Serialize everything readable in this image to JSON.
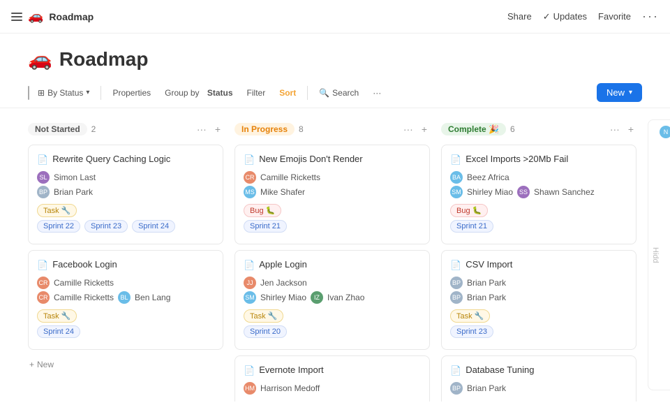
{
  "app": {
    "title": "Roadmap",
    "emoji": "🚗",
    "topnav": {
      "share": "Share",
      "updates": "Updates",
      "favorite": "Favorite",
      "dots": "···"
    }
  },
  "toolbar": {
    "view_by": "By Status",
    "properties": "Properties",
    "group_by_prefix": "Group by",
    "group_by_field": "Status",
    "filter": "Filter",
    "sort": "Sort",
    "search": "Search",
    "more_dots": "···",
    "new_btn": "New"
  },
  "columns": [
    {
      "id": "not-started",
      "label": "Not Started",
      "count": "2",
      "cards": [
        {
          "title": "Rewrite Query Caching Logic",
          "people": [
            "Simon Last",
            "Brian Park"
          ],
          "tag_type": "task",
          "tag_label": "Task 🔧",
          "sprints": [
            "Sprint 22",
            "Sprint 23",
            "Sprint 24"
          ]
        },
        {
          "title": "Facebook Login",
          "people": [
            "Camille Ricketts",
            "Camille Ricketts",
            "Ben Lang"
          ],
          "tag_type": "task",
          "tag_label": "Task 🔧",
          "sprints": [
            "Sprint 24"
          ]
        }
      ]
    },
    {
      "id": "in-progress",
      "label": "In Progress",
      "count": "8",
      "cards": [
        {
          "title": "New Emojis Don't Render",
          "people": [
            "Camille Ricketts",
            "Mike Shafer"
          ],
          "tag_type": "bug",
          "tag_label": "Bug 🐛",
          "sprints": [
            "Sprint 21"
          ]
        },
        {
          "title": "Apple Login",
          "people": [
            "Jen Jackson",
            "Shirley Miao",
            "Ivan Zhao"
          ],
          "tag_type": "task",
          "tag_label": "Task 🔧",
          "sprints": [
            "Sprint 20"
          ]
        },
        {
          "title": "Evernote Import",
          "people": [
            "Harrison Medoff"
          ],
          "tag_type": null,
          "tag_label": null,
          "sprints": []
        }
      ]
    },
    {
      "id": "complete",
      "label": "Complete 🎉",
      "count": "6",
      "cards": [
        {
          "title": "Excel Imports >20Mb Fail",
          "people": [
            "Beez Africa",
            "Shirley Miao",
            "Shawn Sanchez"
          ],
          "tag_type": "bug",
          "tag_label": "Bug 🐛",
          "sprints": [
            "Sprint 21"
          ]
        },
        {
          "title": "CSV Import",
          "people": [
            "Brian Park",
            "Brian Park"
          ],
          "tag_type": "task",
          "tag_label": "Task 🔧",
          "sprints": [
            "Sprint 23"
          ]
        },
        {
          "title": "Database Tuning",
          "people": [
            "Brian Park"
          ],
          "tag_type": null,
          "tag_label": null,
          "sprints": []
        }
      ]
    }
  ],
  "hidden_col_label": "Hidd",
  "new_card_label": "New",
  "avatar_colors": {
    "Simon Last": "#9c6fbd",
    "Brian Park": "#a0b4c8",
    "Camille Ricketts": "#e88a6a",
    "Ben Lang": "#6abde8",
    "Mike Shafer": "#6abde8",
    "Jen Jackson": "#e88a6a",
    "Shirley Miao": "#6abde8",
    "Ivan Zhao": "#5a9e6f",
    "Harrison Medoff": "#e88a6a",
    "Beez Africa": "#6abde8",
    "Shawn Sanchez": "#9c6fbd"
  }
}
